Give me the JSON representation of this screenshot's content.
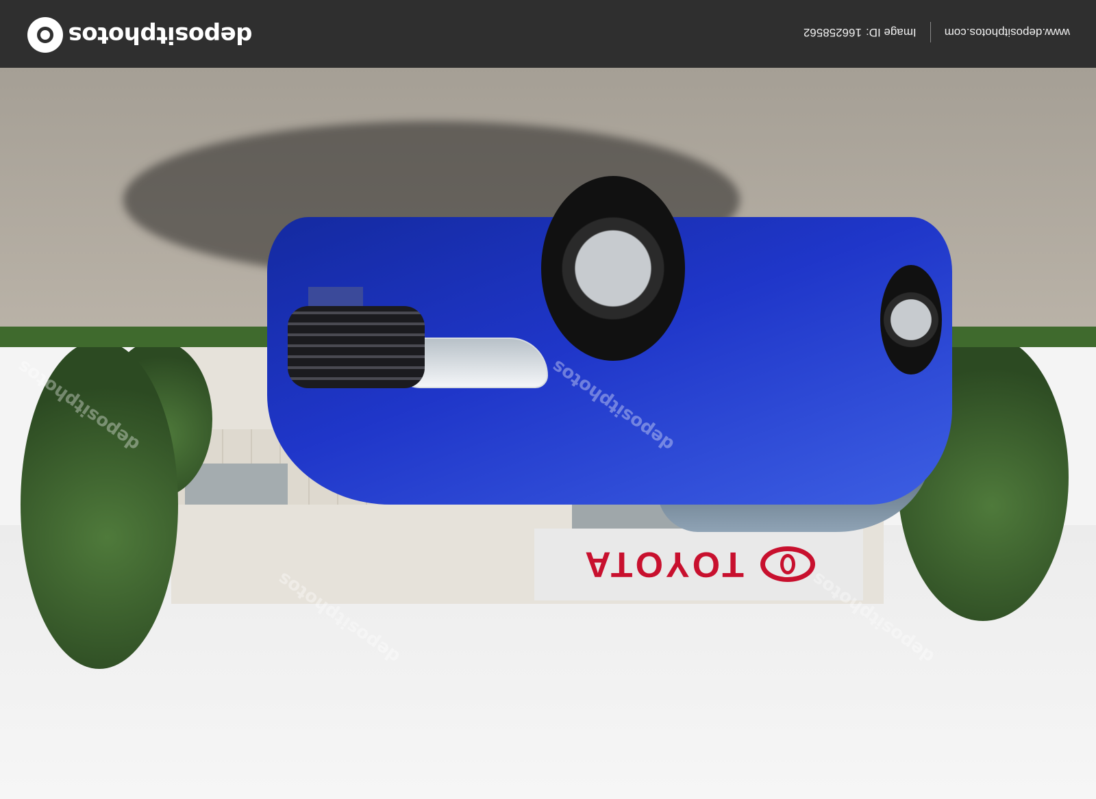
{
  "header": {
    "brand": "depositphotos",
    "image_id_label": "Image ID:",
    "image_id": "166258562",
    "website": "www.depositphotos.com"
  },
  "scene": {
    "sign_text": "TOYOTA",
    "watermark_text": "depositphotos",
    "orientation": "rotated 180 degrees"
  },
  "colors": {
    "header_bg": "#2f2f2f",
    "car_blue": "#1f36c9",
    "toyota_red": "#c8102e"
  },
  "icons": {
    "brand_logo": "camera-aperture-icon"
  }
}
